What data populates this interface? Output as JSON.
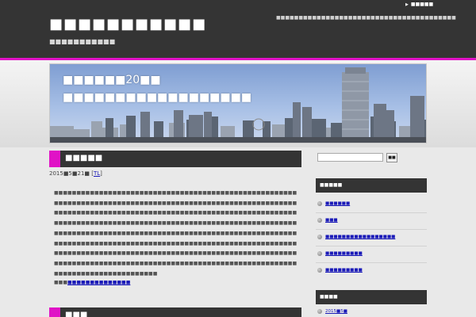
{
  "header": {
    "site_title": "■■■■■■■■■■■",
    "site_description": "■■■■■■■■■■■",
    "tagline": "■■■■■■■■■■■■■■■■■■■■■■■■■■■■■■■■■■■■■■■■",
    "top_link": "■■■■■"
  },
  "banner": {
    "line_1": "■■■■■■20■■",
    "line_2": "■■■■■■■■■■■■■■■■■■"
  },
  "post": {
    "title": "■■■■■",
    "date": "2015■5■21■ [",
    "date_link": "TL",
    "date_close": "]",
    "body": "■■■■■■■■■■■■■■■■■■■■■■■■■■■■■■■■■■■■■■■■■■■■■■■■■■■■■■■■■■■■■■■■■■■■■■■■■■■■■■■■■■■■■■■■■■■■■■■■■■■■■■■■■■■■■■■■■■■■■■■■■■■■■■■■■■■■■■■■■■■■■■■■■■■■■■■■■■■■■■■■■■■■■■■■■■■■■■■■■■■■■■■■■■■■■■■■■■■■■■■■■■■■■■■■■■■■■■■■■■■■■■■■■■■■■■■■■■■■■■■■■■■■■■■■■■■■■■■■■■■■■■■■■■■■■■■■■■■■■■■■■■■■■■■■■■■■■■■■■■■■■■■■■■■■■■■■■■■■■■■■■■■■■■■■■■■■■■■■■■■■■■■■■■■■■■■■■■■■■■■■■■■■■■■■■■■■■■■■■■■■■■■■■■■■■■■■■■■■■■■■■■■■■■■■■■■■■■■■■■■■■■■■■■■■■■■■■■■■■■■■■■■■■■■■■■■■■■■",
    "link_prefix": "■■■",
    "link_text": "■■■■■■■■■■■■■■"
  },
  "post2": {
    "title": "■■■"
  },
  "sidebar": {
    "search_placeholder": "",
    "search_button": "■■",
    "widget1_title": "■■■■■",
    "items": [
      {
        "label": "■■■■■■"
      },
      {
        "label": "■■■"
      },
      {
        "label": "■■■■■■■■■■■■■■■■■"
      },
      {
        "label": "■■■■■■■■■"
      },
      {
        "label": "■■■■■■■■■"
      }
    ],
    "widget2_title": "■■■■",
    "archive_first": "2015■5■"
  },
  "colors": {
    "accent": "#e012c6",
    "bar": "#343434",
    "link": "#1a1ab8"
  }
}
